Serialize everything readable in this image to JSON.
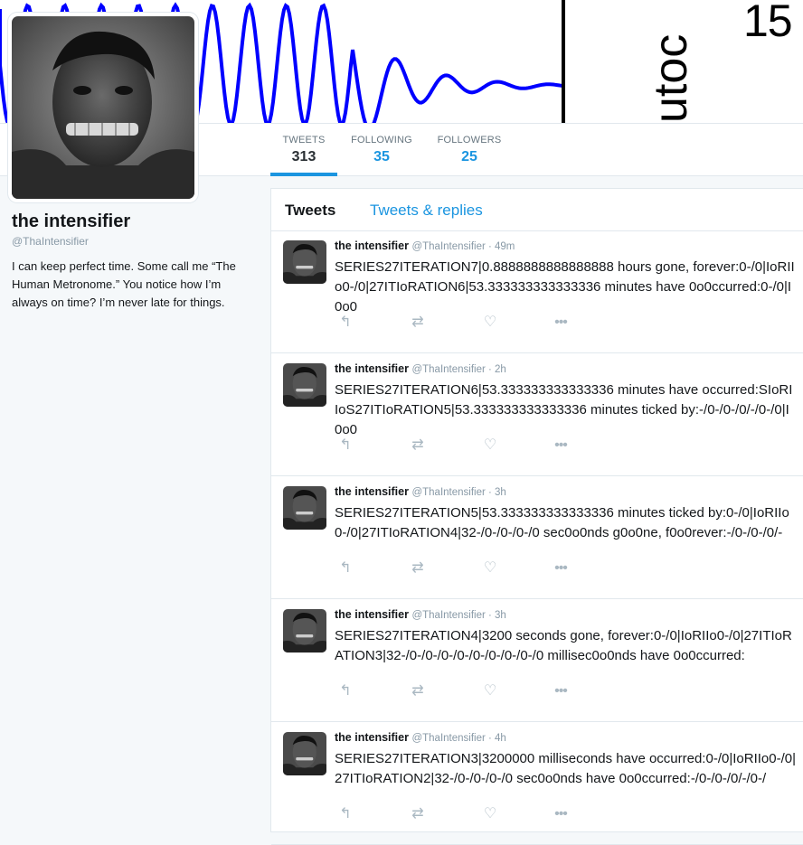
{
  "banner": {
    "ylabel": "utoc",
    "ytick": "15"
  },
  "profile": {
    "name": "the intensifier",
    "handle": "@ThaIntensifier",
    "bio": "I can keep perfect time. Some call me “The Human Metronome.” You notice how I’m always on time? I’m never late for things."
  },
  "stats": [
    {
      "label": "TWEETS",
      "value": "313"
    },
    {
      "label": "FOLLOWING",
      "value": "35"
    },
    {
      "label": "FOLLOWERS",
      "value": "25"
    }
  ],
  "tabs": {
    "tweets": "Tweets",
    "replies": "Tweets & replies"
  },
  "tweets": [
    {
      "name": "the intensifier",
      "meta": "@ThaIntensifier · 49m",
      "text": "SERIES27ITERATION7|0.8888888888888888 hours gone, forever:0-/0|IoRIIo0-/0|27ITIoRATION6|53.333333333333336 minutes have 0o0ccurred:0-/0|I0o0"
    },
    {
      "name": "the intensifier",
      "meta": "@ThaIntensifier · 2h",
      "text": "SERIES27ITERATION6|53.333333333333336 minutes have occurred:SIoRIIoS27ITIoRATION5|53.333333333333336 minutes ticked by:-/0-/0-/0/-/0-/0|I0o0"
    },
    {
      "name": "the intensifier",
      "meta": "@ThaIntensifier · 3h",
      "text": "SERIES27ITERATION5|53.333333333333336 minutes ticked by:0-/0|IoRIIo0-/0|27ITIoRATION4|32-/0-/0-/0-/0 sec0o0nds g0o0ne, f0o0rever:-/0-/0-/0/-"
    },
    {
      "name": "the intensifier",
      "meta": "@ThaIntensifier · 3h",
      "text": "SERIES27ITERATION4|3200 seconds gone, forever:0-/0|IoRIIo0-/0|27ITIoRATION3|32-/0-/0-/0-/0-/0-/0-/0-/0-/0 millisec0o0nds have 0o0ccurred:"
    },
    {
      "name": "the intensifier",
      "meta": "@ThaIntensifier · 4h",
      "text": "SERIES27ITERATION3|3200000 milliseconds have occurred:0-/0|IoRIIo0-/0|27ITIoRATION2|32-/0-/0-/0-/0 sec0o0nds have 0o0ccurred:-/0-/0-/0/-/0-/"
    }
  ],
  "icons": {
    "reply": "reply-icon",
    "retweet": "retweet-icon",
    "like": "like-icon",
    "more": "more-icon"
  }
}
